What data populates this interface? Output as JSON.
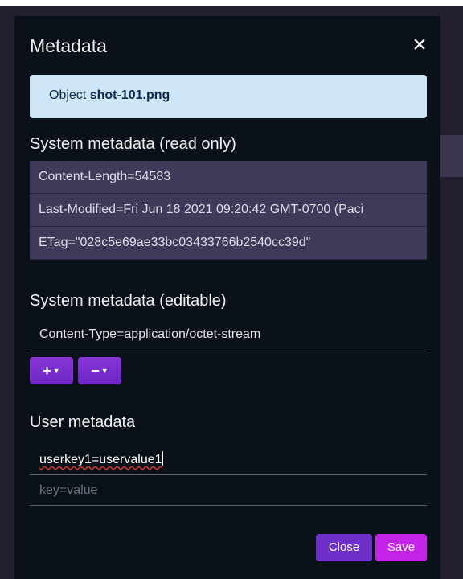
{
  "modal": {
    "title": "Metadata",
    "close_icon": "×"
  },
  "info": {
    "prefix": "Object",
    "object_name": "shot-101.png"
  },
  "system_readonly": {
    "title": "System metadata (read only)",
    "rows": [
      "Content-Length=54583",
      "Last-Modified=Fri Jun 18 2021 09:20:42 GMT-0700 (Paci",
      "ETag=\"028c5e69ae33bc03433766b2540cc39d\""
    ]
  },
  "system_editable": {
    "title": "System metadata (editable)",
    "value": "Content-Type=application/octet-stream",
    "add_label": "+",
    "remove_label": "−"
  },
  "user_metadata": {
    "title": "User metadata",
    "entry_value": "userkey1=uservalue1",
    "new_placeholder": "key=value"
  },
  "footer": {
    "close_label": "Close",
    "save_label": "Save"
  },
  "icons": [
    "close-icon",
    "plus-icon",
    "minus-icon",
    "caret-down-icon"
  ],
  "colors": {
    "modal_bg": "#0b1119",
    "info_bg": "#cfe6f8",
    "readonly_row_bg": "#403a5a",
    "close_button": "#6d2fc8",
    "save_button": "#c223e6"
  }
}
